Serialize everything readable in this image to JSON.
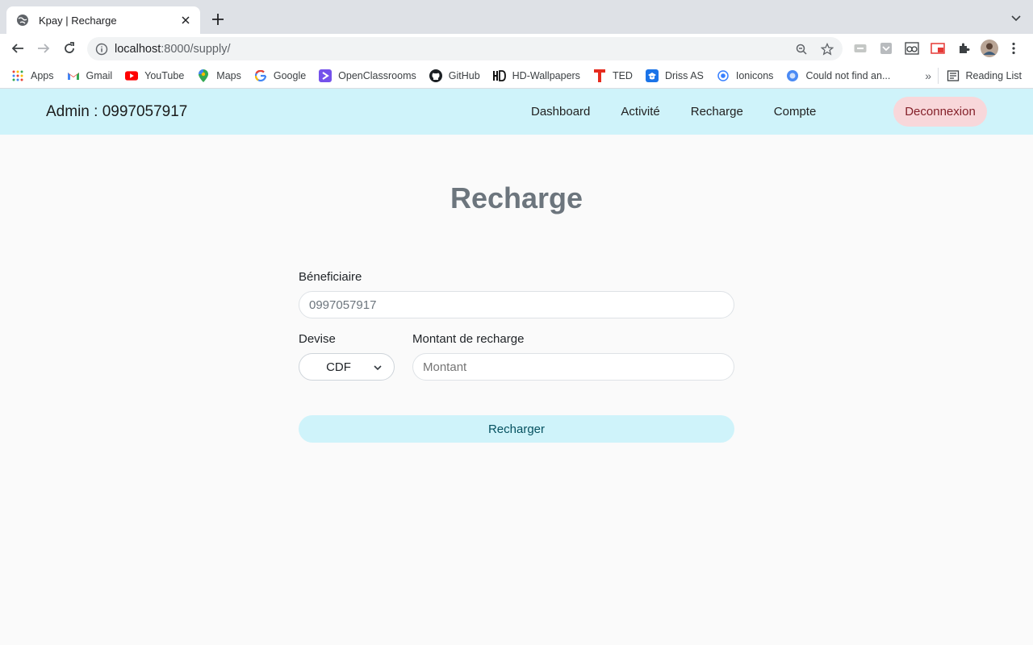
{
  "browser": {
    "tab_title": "Kpay | Recharge",
    "url_host": "localhost",
    "url_rest": ":8000/supply/",
    "bookmarks": [
      {
        "label": "Apps",
        "icon": "apps-grid-icon"
      },
      {
        "label": "Gmail",
        "icon": "gmail-icon"
      },
      {
        "label": "YouTube",
        "icon": "youtube-icon"
      },
      {
        "label": "Maps",
        "icon": "maps-icon"
      },
      {
        "label": "Google",
        "icon": "google-icon"
      },
      {
        "label": "OpenClassrooms",
        "icon": "openclassrooms-icon"
      },
      {
        "label": "GitHub",
        "icon": "github-icon"
      },
      {
        "label": "HD-Wallpapers",
        "icon": "hd-wallpapers-icon"
      },
      {
        "label": "TED",
        "icon": "ted-icon"
      },
      {
        "label": "Driss AS",
        "icon": "driss-icon"
      },
      {
        "label": "Ionicons",
        "icon": "ionicons-icon"
      },
      {
        "label": "Could not find an...",
        "icon": "bookmark-globe-icon"
      }
    ],
    "reading_list": "Reading List",
    "more_bookmarks": "»"
  },
  "navbar": {
    "brand": "Admin : 0997057917",
    "links": [
      "Dashboard",
      "Activité",
      "Recharge",
      "Compte"
    ],
    "logout": "Deconnexion"
  },
  "page": {
    "title": "Recharge",
    "beneficiary_label": "Béneficiaire",
    "beneficiary_value": "0997057917",
    "currency_label": "Devise",
    "currency_value": "CDF",
    "amount_label": "Montant de recharge",
    "amount_placeholder": "Montant",
    "submit": "Recharger"
  },
  "colors": {
    "navbar_bg": "#cff3fa",
    "logout_bg": "#f8d7da",
    "submit_bg": "#cff3fa"
  }
}
